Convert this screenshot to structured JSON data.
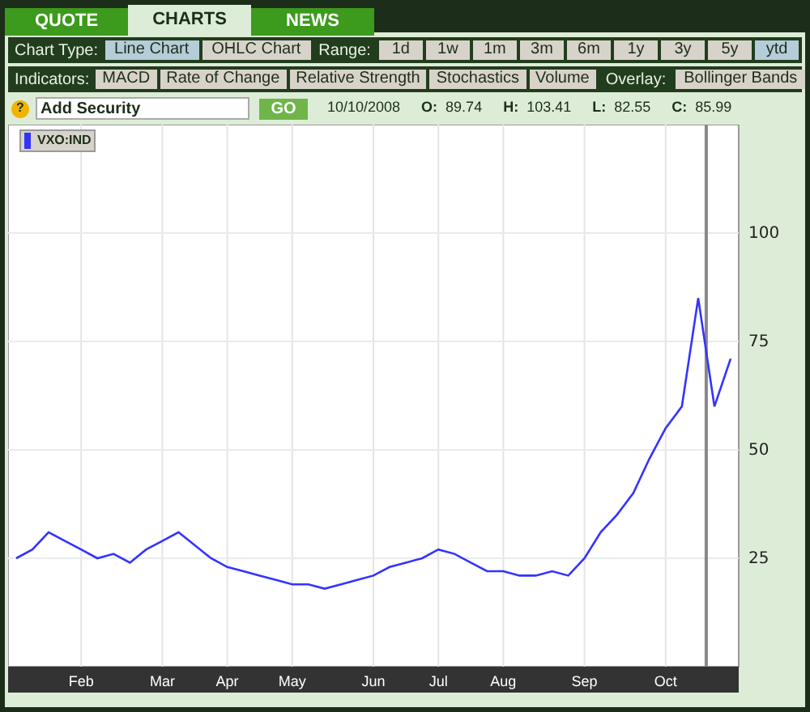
{
  "tabs": [
    {
      "label": "QUOTE",
      "selected": false
    },
    {
      "label": "CHARTS",
      "selected": true
    },
    {
      "label": "NEWS",
      "selected": false
    }
  ],
  "chart_type": {
    "label": "Chart Type:",
    "options": [
      {
        "label": "Line Chart",
        "selected": true
      },
      {
        "label": "OHLC Chart",
        "selected": false
      }
    ]
  },
  "range": {
    "label": "Range:",
    "options": [
      {
        "label": "1d",
        "selected": false
      },
      {
        "label": "1w",
        "selected": false
      },
      {
        "label": "1m",
        "selected": false
      },
      {
        "label": "3m",
        "selected": false
      },
      {
        "label": "6m",
        "selected": false
      },
      {
        "label": "1y",
        "selected": false
      },
      {
        "label": "3y",
        "selected": false
      },
      {
        "label": "5y",
        "selected": false
      },
      {
        "label": "ytd",
        "selected": true
      }
    ]
  },
  "indicators": {
    "label": "Indicators:",
    "options": [
      "MACD",
      "Rate of Change",
      "Relative Strength",
      "Stochastics",
      "Volume"
    ]
  },
  "overlay": {
    "label": "Overlay:",
    "options": [
      "Bollinger Bands"
    ]
  },
  "search": {
    "help": "?",
    "value": "Add Security",
    "button": "GO"
  },
  "quote": {
    "date": "10/10/2008",
    "stats": [
      {
        "label": "O:",
        "value": "89.74"
      },
      {
        "label": "H:",
        "value": "103.41"
      },
      {
        "label": "L:",
        "value": "82.55"
      },
      {
        "label": "C:",
        "value": "85.99"
      }
    ]
  },
  "chart": {
    "chart_data": {
      "type": "line",
      "categories": [
        null,
        null,
        null,
        null,
        "Feb",
        null,
        null,
        null,
        null,
        "Mar",
        null,
        null,
        null,
        "Apr",
        null,
        null,
        null,
        "May",
        null,
        null,
        null,
        null,
        "Jun",
        null,
        null,
        null,
        "Jul",
        null,
        null,
        null,
        "Aug",
        null,
        null,
        null,
        null,
        "Sep",
        null,
        null,
        null,
        null,
        "Oct",
        null,
        null,
        null,
        null
      ],
      "series": [
        {
          "name": "VXO:IND",
          "color": "#3333ff",
          "values": [
            25,
            27,
            31,
            29,
            27,
            25,
            26,
            24,
            27,
            29,
            31,
            28,
            25,
            23,
            22,
            21,
            20,
            19,
            19,
            18,
            19,
            20,
            21,
            23,
            24,
            25,
            27,
            26,
            24,
            22,
            22,
            21,
            21,
            22,
            21,
            25,
            31,
            35,
            40,
            48,
            55,
            60,
            85,
            60,
            71
          ]
        }
      ],
      "ylim": [
        0,
        125
      ],
      "grid": true,
      "yticks": [
        25,
        50,
        75,
        100
      ]
    }
  }
}
